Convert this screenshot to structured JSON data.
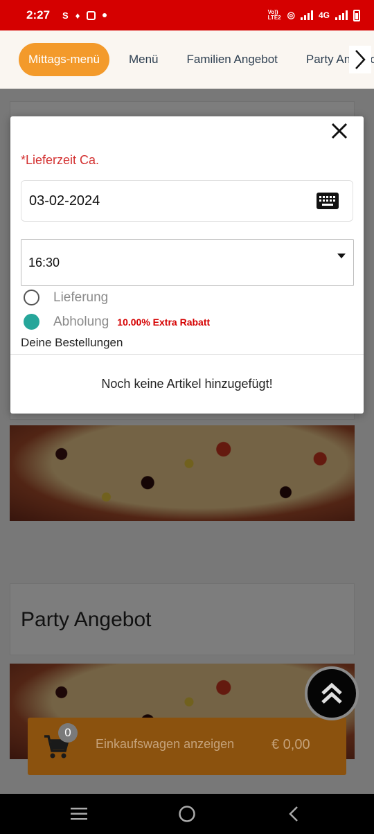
{
  "status_bar": {
    "time": "2:27",
    "network": "4G",
    "volte": "Vo)) LTE2"
  },
  "categories": {
    "items": [
      {
        "label": "Mittags-menü",
        "active": true
      },
      {
        "label": "Menü",
        "active": false
      },
      {
        "label": "Familien Angebot",
        "active": false
      },
      {
        "label": "Party Angebot",
        "active": false
      }
    ],
    "next_icon": "chevron-right-icon"
  },
  "background": {
    "section_title": "Party Angebot"
  },
  "modal": {
    "delivery_time_label": "*Lieferzeit Ca.",
    "date_value": "03-02-2024",
    "time_value": "16:30",
    "options": [
      {
        "label": "Lieferung",
        "checked": false
      },
      {
        "label": "Abholung",
        "checked": true,
        "badge": "10.00% Extra Rabatt"
      }
    ],
    "orders_title": "Deine Bestellungen",
    "empty_message": "Noch keine Artikel hinzugefügt!"
  },
  "cart": {
    "count": "0",
    "label": "Einkaufswagen anzeigen",
    "total": "€ 0,00"
  },
  "colors": {
    "status_bar": "#d50000",
    "accent": "#f39a2b",
    "radio_checked": "#26a69a",
    "rabatt": "#d50000"
  }
}
